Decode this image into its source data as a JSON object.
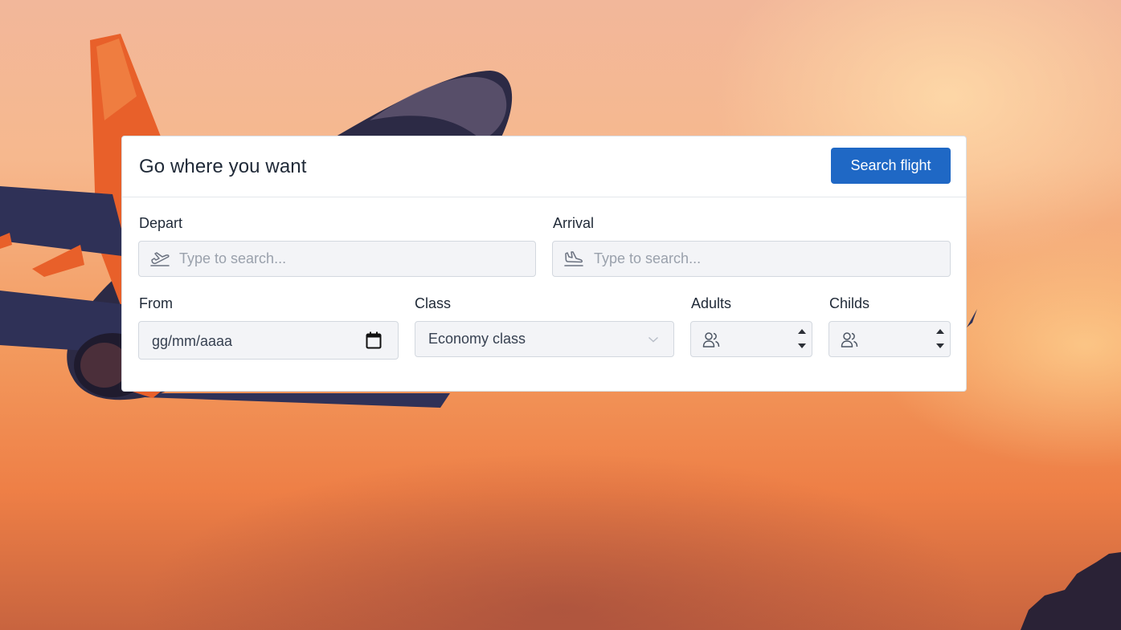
{
  "card": {
    "title": "Go where you want",
    "search_button": "Search flight"
  },
  "form": {
    "depart": {
      "label": "Depart",
      "placeholder": "Type to search...",
      "icon": "plane-takeoff-icon"
    },
    "arrival": {
      "label": "Arrival",
      "placeholder": "Type to search...",
      "icon": "plane-landing-icon"
    },
    "from": {
      "label": "From",
      "value": "gg/mm/aaaa",
      "icon": "calendar-icon"
    },
    "class": {
      "label": "Class",
      "value": "Economy class",
      "icon": "chevron-down-icon"
    },
    "adults": {
      "label": "Adults",
      "icon": "users-icon"
    },
    "childs": {
      "label": "Childs",
      "icon": "users-icon"
    }
  },
  "colors": {
    "accent": "#1f68c5",
    "field_bg": "#f3f4f7",
    "text": "#1f2937"
  }
}
